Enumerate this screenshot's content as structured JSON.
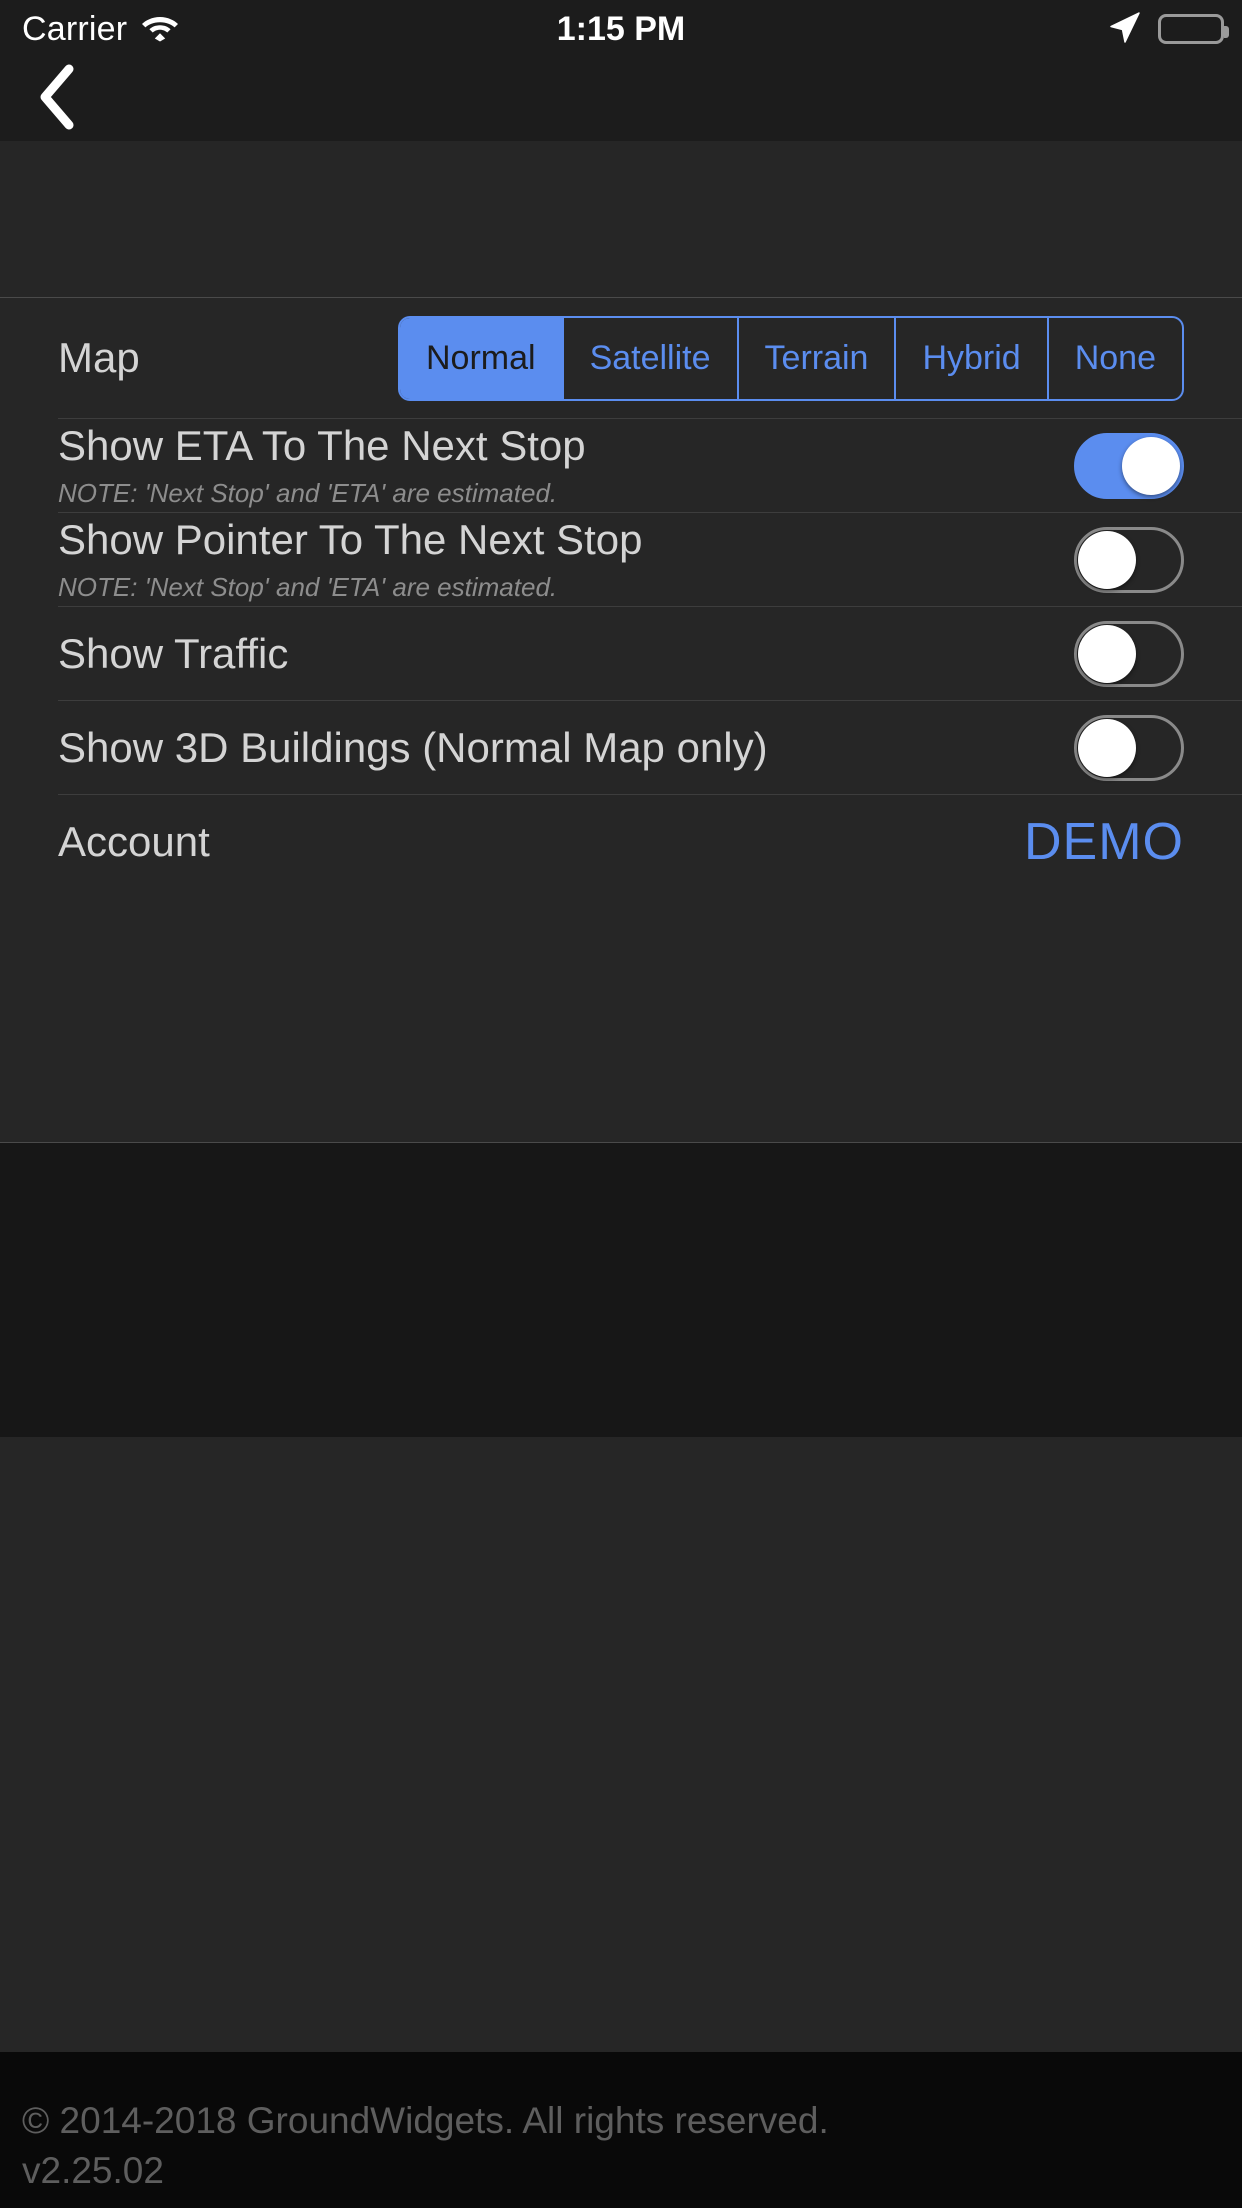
{
  "status_bar": {
    "carrier": "Carrier",
    "time": "1:15 PM",
    "wifi_icon": "wifi-icon",
    "location_icon": "location-arrow-icon",
    "battery_icon": "battery-full-icon"
  },
  "nav_bar": {
    "back_icon": "chevron-left-icon"
  },
  "settings": {
    "map_row": {
      "label": "Map",
      "options": [
        "Normal",
        "Satellite",
        "Terrain",
        "Hybrid",
        "None"
      ],
      "selected": "Normal"
    },
    "rows": [
      {
        "title": "Show ETA To The Next Stop",
        "note": "NOTE: 'Next Stop' and 'ETA' are estimated.",
        "toggle": "on"
      },
      {
        "title": "Show Pointer To The Next Stop",
        "note": "NOTE: 'Next Stop' and 'ETA' are estimated.",
        "toggle": "off"
      },
      {
        "title": "Show Traffic",
        "note": "",
        "toggle": "off"
      },
      {
        "title": "Show 3D Buildings (Normal Map only)",
        "note": "",
        "toggle": "off"
      }
    ],
    "account_row": {
      "label": "Account",
      "value": "DEMO"
    }
  },
  "footer": {
    "copyright": "© 2014-2018 GroundWidgets.  All rights reserved.",
    "version": "v2.25.02"
  },
  "colors": {
    "accent": "#5b8def",
    "background": "#262626",
    "bar": "#1c1c1c",
    "text_primary": "#d4d4d4",
    "text_secondary": "#8d8d8d",
    "footer_text": "#5e5e5e"
  }
}
